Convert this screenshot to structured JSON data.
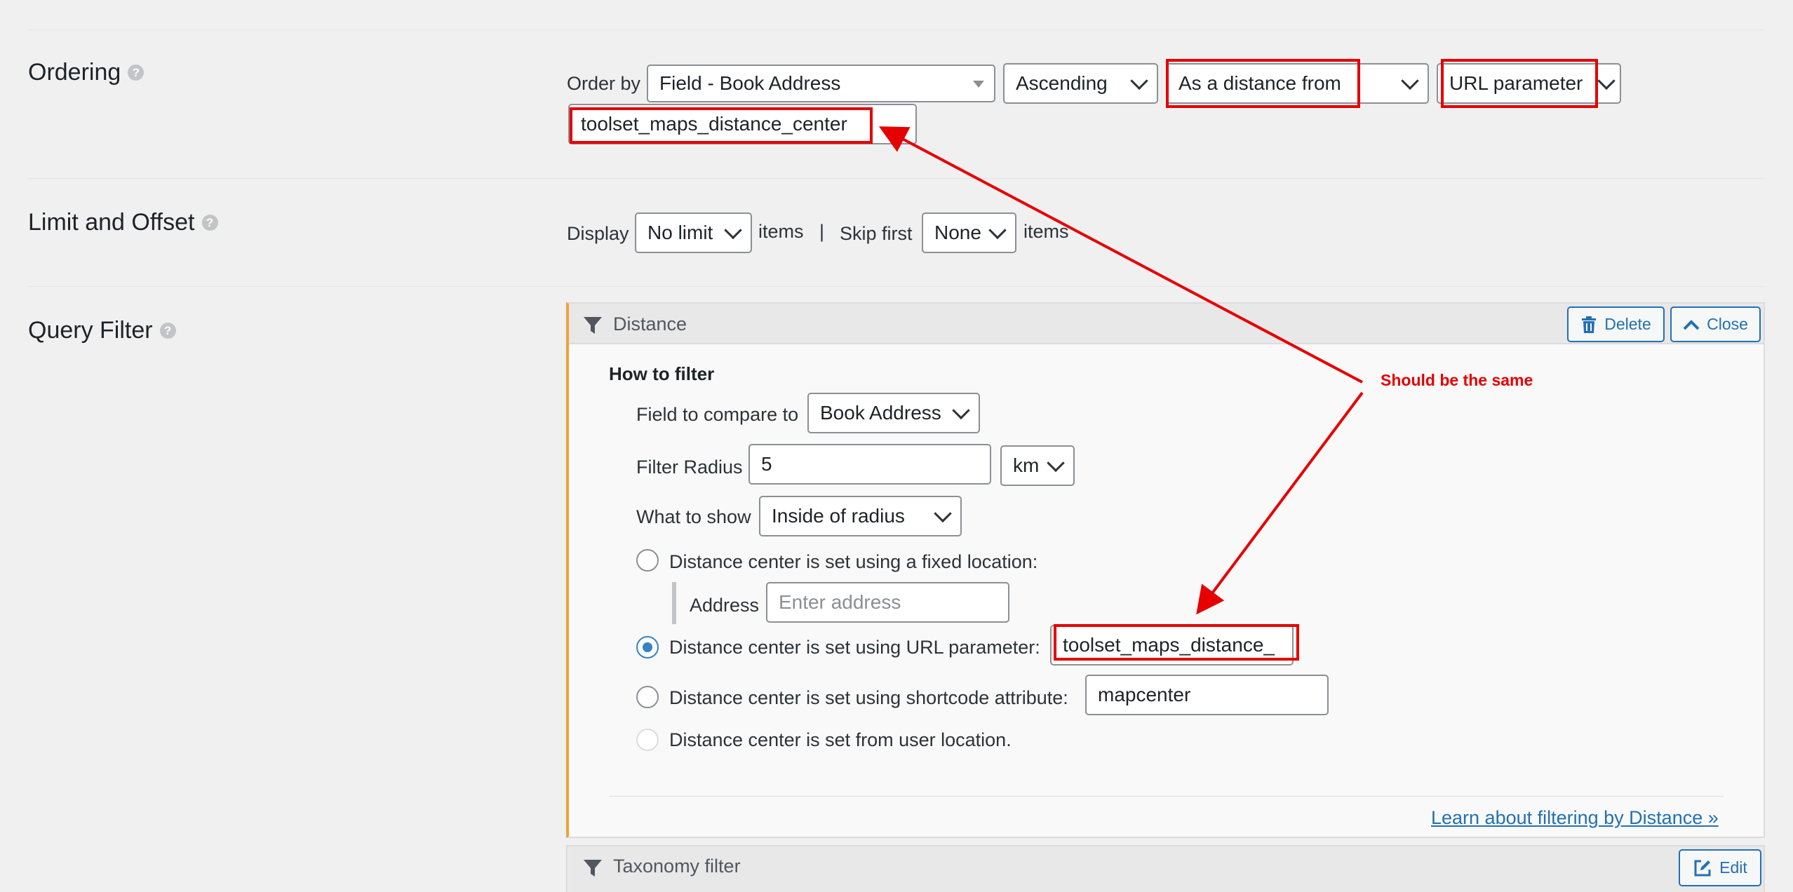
{
  "ordering": {
    "title": "Ordering",
    "order_by_label": "Order by",
    "order_by_value": "Field - Book Address",
    "direction": "Ascending",
    "distance_mode": "As a distance from",
    "source": "URL parameter",
    "param_value": "toolset_maps_distance_center"
  },
  "limit": {
    "title": "Limit and Offset",
    "display_label": "Display",
    "display_value": "No limit",
    "items_label": "items",
    "separator": "|",
    "skip_label": "Skip first",
    "skip_value": "None",
    "items_label2": "items"
  },
  "query_filter": {
    "title": "Query Filter",
    "help": "?",
    "distance_panel": {
      "title": "Distance",
      "delete_label": "Delete",
      "close_label": "Close",
      "how_to_filter": "How to filter",
      "field_label": "Field to compare to",
      "field_value": "Book Address",
      "radius_label": "Filter Radius",
      "radius_value": "5",
      "unit_value": "km",
      "show_label": "What to show",
      "show_value": "Inside of radius",
      "opt_fixed": "Distance center is set using a fixed location:",
      "address_label": "Address",
      "address_placeholder": "Enter address",
      "opt_url": "Distance center is set using URL parameter:",
      "url_value": "toolset_maps_distance_",
      "opt_shortcode": "Distance center is set using shortcode attribute:",
      "shortcode_value": "mapcenter",
      "opt_user": "Distance center is set from user location.",
      "learn_link": "Learn about filtering by Distance »"
    },
    "taxonomy_panel": {
      "title": "Taxonomy filter",
      "edit_label": "Edit"
    }
  },
  "annotation": {
    "text": "Should be the same",
    "color": "#e60000"
  },
  "colors": {
    "accent": "#2271b1",
    "panel_border_left": "#f0a138",
    "annotation": "#e60000"
  },
  "icons": {
    "help": "help-circle-icon",
    "filter": "funnel-icon",
    "delete": "trash-icon",
    "close": "chevron-up-icon",
    "edit": "pencil-square-icon"
  }
}
